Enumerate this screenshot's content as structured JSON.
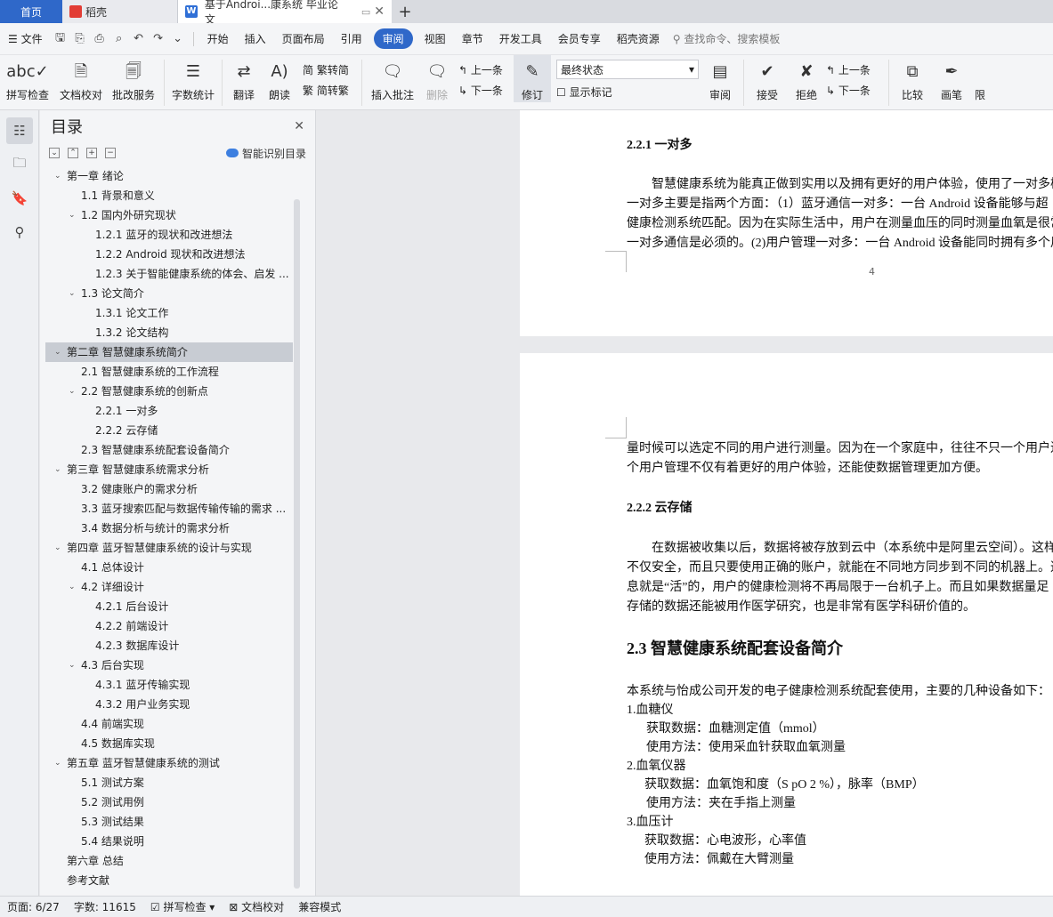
{
  "tabs": {
    "home": "首页",
    "daoke": "稻壳",
    "doc": "基于Androi...康系统 毕业论文"
  },
  "menu": {
    "file": "文件",
    "items": [
      "开始",
      "插入",
      "页面布局",
      "引用",
      "审阅",
      "视图",
      "章节",
      "开发工具",
      "会员专享",
      "稻壳资源"
    ],
    "active": "审阅",
    "search": "查找命令、搜索模板"
  },
  "ribbon": {
    "spell": "拼写检查",
    "proof": "文档校对",
    "batch": "批改服务",
    "count": "字数统计",
    "translate": "翻译",
    "read": "朗读",
    "t2s": "繁转简",
    "s2t": "简转繁",
    "insert_comment": "插入批注",
    "delete": "删除",
    "prev": "上一条",
    "next": "下一条",
    "revise": "修订",
    "state": "最终状态",
    "show_marks": "显示标记",
    "review": "审阅",
    "accept": "接受",
    "reject": "拒绝",
    "prev2": "上一条",
    "next2": "下一条",
    "compare": "比较",
    "pen": "画笔",
    "more": "限"
  },
  "toc": {
    "title": "目录",
    "smart": "智能识别目录",
    "items": [
      {
        "t": "第一章 绪论",
        "l": 0,
        "c": 1
      },
      {
        "t": "1.1 背景和意义",
        "l": 1,
        "c": 0
      },
      {
        "t": "1.2 国内外研究现状",
        "l": 1,
        "c": 1
      },
      {
        "t": "1.2.1  蓝牙的现状和改进想法",
        "l": 2,
        "c": 0
      },
      {
        "t": "1.2.2 Android 现状和改进想法",
        "l": 2,
        "c": 0
      },
      {
        "t": "1.2.3  关于智能健康系统的体会、启发 ...",
        "l": 2,
        "c": 0
      },
      {
        "t": "1.3 论文简介",
        "l": 1,
        "c": 1
      },
      {
        "t": "1.3.1 论文工作",
        "l": 2,
        "c": 0
      },
      {
        "t": "1.3.2 论文结构",
        "l": 2,
        "c": 0
      },
      {
        "t": "第二章  智慧健康系统简介",
        "l": 0,
        "c": 1,
        "sel": 1
      },
      {
        "t": "2.1 智慧健康系统的工作流程",
        "l": 1,
        "c": 0
      },
      {
        "t": "2.2 智慧健康系统的创新点",
        "l": 1,
        "c": 1
      },
      {
        "t": "2.2.1 一对多",
        "l": 2,
        "c": 0
      },
      {
        "t": "2.2.2 云存储",
        "l": 2,
        "c": 0
      },
      {
        "t": "2.3 智慧健康系统配套设备简介",
        "l": 1,
        "c": 0
      },
      {
        "t": "第三章  智慧健康系统需求分析",
        "l": 0,
        "c": 1
      },
      {
        "t": "3.2 健康账户的需求分析",
        "l": 1,
        "c": 0
      },
      {
        "t": "3.3 蓝牙搜索匹配与数据传输传输的需求 ...",
        "l": 1,
        "c": 0
      },
      {
        "t": "3.4 数据分析与统计的需求分析",
        "l": 1,
        "c": 0
      },
      {
        "t": "第四章  蓝牙智慧健康系统的设计与实现",
        "l": 0,
        "c": 1
      },
      {
        "t": "4.1 总体设计",
        "l": 1,
        "c": 0
      },
      {
        "t": "4.2 详细设计",
        "l": 1,
        "c": 1
      },
      {
        "t": "4.2.1 后台设计",
        "l": 2,
        "c": 0
      },
      {
        "t": "4.2.2 前端设计",
        "l": 2,
        "c": 0
      },
      {
        "t": "4.2.3 数据库设计",
        "l": 2,
        "c": 0
      },
      {
        "t": "4.3 后台实现",
        "l": 1,
        "c": 1
      },
      {
        "t": "4.3.1 蓝牙传输实现",
        "l": 2,
        "c": 0
      },
      {
        "t": "4.3.2 用户业务实现",
        "l": 2,
        "c": 0
      },
      {
        "t": "4.4 前端实现",
        "l": 1,
        "c": 0
      },
      {
        "t": "4.5 数据库实现",
        "l": 1,
        "c": 0
      },
      {
        "t": "第五章  蓝牙智慧健康系统的测试",
        "l": 0,
        "c": 1
      },
      {
        "t": "5.1 测试方案",
        "l": 1,
        "c": 0
      },
      {
        "t": "5.2 测试用例",
        "l": 1,
        "c": 0
      },
      {
        "t": "5.3 测试结果",
        "l": 1,
        "c": 0
      },
      {
        "t": "5.4 结果说明",
        "l": 1,
        "c": 0
      },
      {
        "t": "第六章  总结",
        "l": 0,
        "c": 0
      },
      {
        "t": "参考文献",
        "l": 0,
        "c": 0
      }
    ]
  },
  "page1": {
    "heading": "2.2.1 一对多",
    "lines": [
      "智慧健康系统为能真正做到实用以及拥有更好的用户体验，使用了一对多模",
      "一对多主要是指两个方面：（1）蓝牙通信一对多：一台 Android 设备能够与超",
      "健康检测系统匹配。因为在实际生活中，用户在测量血压的同时测量血氧是很常",
      "一对多通信是必须的。(2)用户管理一对多：一台 Android 设备能同时拥有多个用"
    ],
    "page_number": "4"
  },
  "page2": {
    "lines_top": [
      "量时候可以选定不同的用户进行测量。因为在一个家庭中，往往不只一个用户进",
      "个用户管理不仅有着更好的用户体验，还能使数据管理更加方便。"
    ],
    "h_cloud": "2.2.2 云存储",
    "lines_cloud": [
      "在数据被收集以后，数据将被存放到云中（本系统中是阿里云空间）。这样",
      "不仅安全，而且只要使用正确的账户，就能在不同地方同步到不同的机器上。这",
      "息就是“活”的，用户的健康检测将不再局限于一台机子上。而且如果数据量足",
      "存储的数据还能被用作医学研究，也是非常有医学科研价值的。"
    ],
    "h_devices": "2.3 智慧健康系统配套设备简介",
    "intro": "本系统与怡成公司开发的电子健康检测系统配套使用，主要的几种设备如下：",
    "devices": [
      "1.血糖仪",
      "获取数据：血糖测定值（mmol）",
      "使用方法：使用采血针获取血氧测量",
      "2.血氧仪器",
      "获取数据：血氧饱和度（S pO 2  %），脉率（BMP）",
      "使用方法：夹在手指上测量",
      "3.血压计",
      "获取数据：心电波形，心率值",
      "使用方法：佩戴在大臂测量"
    ]
  },
  "status": {
    "page": "页面: 6/27",
    "words": "字数: 11615",
    "spell": "拼写检查",
    "proof": "文档校对",
    "compat": "兼容模式"
  }
}
